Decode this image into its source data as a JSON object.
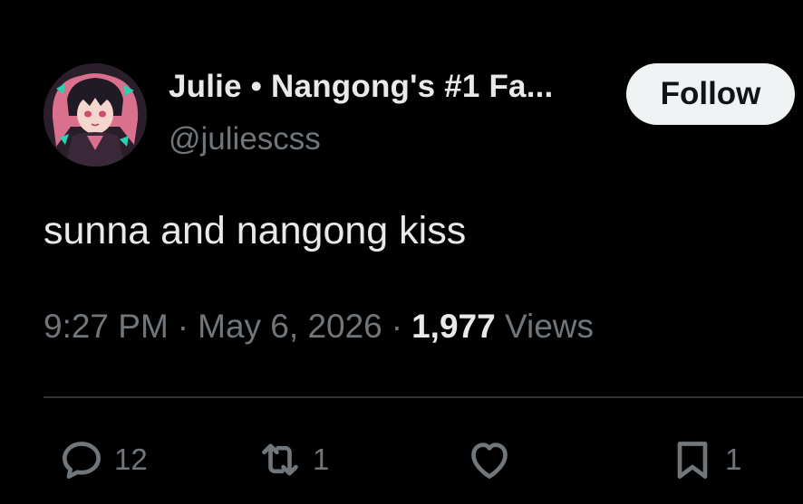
{
  "tweet": {
    "author": {
      "display_name": "Julie • Nangong's #1 Fa...",
      "handle": "@juliescss"
    },
    "follow_label": "Follow",
    "text": "sunna and nangong kiss",
    "time": "9:27 PM",
    "date": "May 6, 2026",
    "separator": "·",
    "views_count": "1,977",
    "views_label": "Views"
  },
  "actions": {
    "reply": {
      "icon": "reply-icon",
      "count": "12"
    },
    "repost": {
      "icon": "repost-icon",
      "count": "1"
    },
    "like": {
      "icon": "heart-icon",
      "count": ""
    },
    "bookmark": {
      "icon": "bookmark-icon",
      "count": "1"
    }
  },
  "colors": {
    "background": "#000000",
    "primary_text": "#e7e9ea",
    "secondary_text": "#71767b",
    "follow_button_bg": "#eff3f4",
    "divider": "#2f3336"
  }
}
